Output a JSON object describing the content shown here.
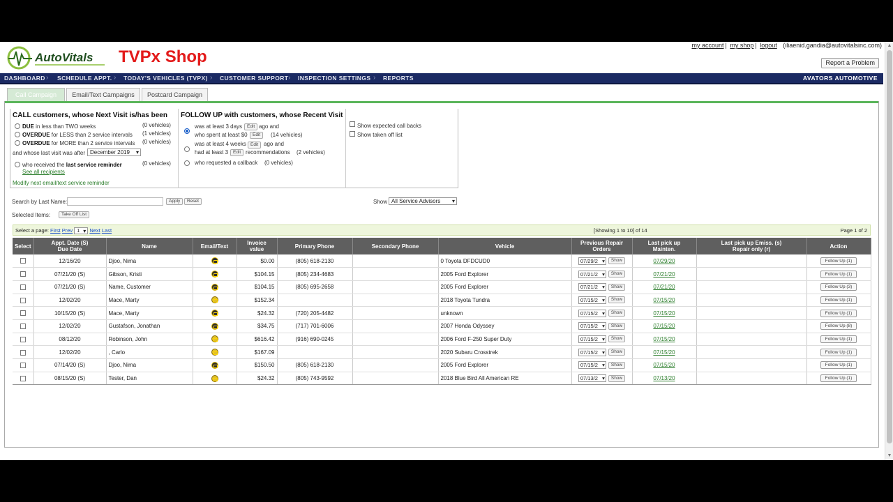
{
  "header": {
    "logo_text": "AutoVitals",
    "shop_title": "TVPx Shop",
    "links": [
      "my account",
      "my shop",
      "logout"
    ],
    "user_email": "(iliaenid.gandia@autovitalsinc.com)",
    "report_button": "Report a Problem"
  },
  "nav": {
    "items": [
      "DASHBOARD",
      "SCHEDULE APPT.",
      "TODAY'S VEHICLES (TVPX)",
      "CUSTOMER SUPPORT",
      "INSPECTION SETTINGS",
      "REPORTS"
    ],
    "brand": "AVATORS AUTOMOTIVE"
  },
  "tabs": [
    "Call Campaign",
    "Email/Text Campaigns",
    "Postcard Campaign"
  ],
  "call_panel": {
    "heading": "CALL customers, whose Next Visit is/has been",
    "opt1_bold": "DUE",
    "opt1_rest": " in less than TWO weeks",
    "opt1_count": "(0 vehicles)",
    "opt2_bold": "OVERDUE",
    "opt2_rest": " for LESS than 2 service intervals",
    "opt2_count": "(1 vehicles)",
    "opt3_bold": "OVERDUE",
    "opt3_rest": " for MORE than 2 service intervals",
    "opt3_count": "(0 vehicles)",
    "last_visit_label": "and whose last visit was after",
    "last_visit_value": "December 2019",
    "opt4_pre": "who received the ",
    "opt4_bold": "last service reminder",
    "opt4_count": "(0 vehicles)",
    "see_all": "See all recipients",
    "modify_link": "Modify next email/text service reminder"
  },
  "followup_panel": {
    "heading": "FOLLOW UP with customers, whose Recent Visit",
    "o1_l1a": "was at least 3 days",
    "o1_l1b": "ago and",
    "o1_l2": "who spent at least $0",
    "o1_count": "(14 vehicles)",
    "o2_l1a": "was at least 4 weeks",
    "o2_l1b": "ago and",
    "o2_l2a": "had at least 3",
    "o2_l2b": "recommendations",
    "o2_count": "(2 vehicles)",
    "o3": "who requested a callback",
    "o3_count": "(0 vehicles)",
    "edit": "Edit"
  },
  "options_panel": {
    "show_expected": "Show expected call backs",
    "show_taken": "Show taken off list"
  },
  "search": {
    "label": "Search by Last Name:",
    "apply": "Apply",
    "reset": "Reset",
    "show_label": "Show",
    "show_value": "All Service Advisors",
    "selected_items": "Selected Items:",
    "take_off": "Take Off List"
  },
  "pager": {
    "select_page": "Select a page:",
    "first": "First",
    "prev": "Prev",
    "page_value": "1",
    "next": "Next",
    "last": "Last",
    "showing": "[Showing 1 to 10] of 14",
    "page_of": "Page 1 of 2"
  },
  "table": {
    "headers": [
      "Select",
      "Appt. Date (S)\nDue Date",
      "Name",
      "Email/Text",
      "Invoice\nvalue",
      "Primary Phone",
      "Secondary Phone",
      "Vehicle",
      "Previous Repair\nOrders",
      "Last pick up\nMainten.",
      "Last pick up Emiss. (s)\nRepair only (r)",
      "Action"
    ],
    "show_label": "Show",
    "rows": [
      {
        "date": "12/16/20",
        "name": "Djoo, Nima",
        "icon": "dark",
        "invoice": "$0.00",
        "phone": "(805) 618-2130",
        "phone2": "",
        "vehicle": "0 Toyota DFDCUD0",
        "ro": "07/29/2",
        "pickup": "07/29/20",
        "emis": "",
        "action": "Follow Up (1)"
      },
      {
        "date": "07/21/20 (S)",
        "name": "Gibson, Kristi",
        "icon": "dark",
        "invoice": "$104.15",
        "phone": "(805) 234-4683",
        "phone2": "",
        "vehicle": "2005 Ford Explorer",
        "ro": "07/21/2",
        "pickup": "07/21/20",
        "emis": "",
        "action": "Follow Up (1)"
      },
      {
        "date": "07/21/20 (S)",
        "name": "Name, Customer",
        "icon": "dark",
        "invoice": "$104.15",
        "phone": "(805) 695-2658",
        "phone2": "",
        "vehicle": "2005 Ford Explorer",
        "ro": "07/21/2",
        "pickup": "07/21/20",
        "emis": "",
        "action": "Follow Up (3)"
      },
      {
        "date": "12/02/20",
        "name": "Mace, Marty",
        "icon": "yel",
        "invoice": "$152.34",
        "phone": "",
        "phone2": "",
        "vehicle": "2018 Toyota Tundra",
        "ro": "07/15/2",
        "pickup": "07/15/20",
        "emis": "",
        "action": "Follow Up (1)"
      },
      {
        "date": "10/15/20 (S)",
        "name": "Mace, Marty",
        "icon": "dark",
        "invoice": "$24.32",
        "phone": "(720) 205-4482",
        "phone2": "",
        "vehicle": "unknown",
        "ro": "07/15/2",
        "pickup": "07/15/20",
        "emis": "",
        "action": "Follow Up (1)"
      },
      {
        "date": "12/02/20",
        "name": "Gustafson, Jonathan",
        "icon": "dark",
        "invoice": "$34.75",
        "phone": "(717) 701-6006",
        "phone2": "",
        "vehicle": "2007 Honda Odyssey",
        "ro": "07/15/2",
        "pickup": "07/15/20",
        "emis": "",
        "action": "Follow Up (8)"
      },
      {
        "date": "08/12/20",
        "name": "Robinson, John",
        "icon": "yel",
        "invoice": "$616.42",
        "phone": "(916) 690-0245",
        "phone2": "",
        "vehicle": "2006 Ford F-250 Super Duty",
        "ro": "07/15/2",
        "pickup": "07/15/20",
        "emis": "",
        "action": "Follow Up (1)"
      },
      {
        "date": "12/02/20",
        "name": ", Carlo",
        "icon": "yel",
        "invoice": "$167.09",
        "phone": "",
        "phone2": "",
        "vehicle": "2020 Subaru Crosstrek",
        "ro": "07/15/2",
        "pickup": "07/15/20",
        "emis": "",
        "action": "Follow Up (1)"
      },
      {
        "date": "07/14/20 (S)",
        "name": "Djoo, Nima",
        "icon": "dark",
        "invoice": "$150.50",
        "phone": "(805) 618-2130",
        "phone2": "",
        "vehicle": "2005 Ford Explorer",
        "ro": "07/15/2",
        "pickup": "07/15/20",
        "emis": "",
        "action": "Follow Up (1)"
      },
      {
        "date": "08/15/20 (S)",
        "name": "Tester, Dan",
        "icon": "yel",
        "invoice": "$24.32",
        "phone": "(805) 743-9592",
        "phone2": "",
        "vehicle": "2018 Blue Bird All American RE",
        "ro": "07/13/2",
        "pickup": "07/13/20",
        "emis": "",
        "action": "Follow Up (1)"
      }
    ]
  }
}
